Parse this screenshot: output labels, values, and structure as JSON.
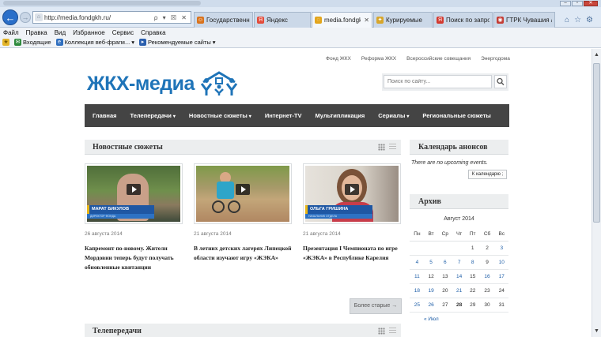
{
  "browser": {
    "address_url": "http://media.fondgkh.ru/",
    "address_tools": "ρ ▾ ☒ ✕",
    "tabs": [
      {
        "label": "Государственная ..."
      },
      {
        "label": "Яндекс"
      },
      {
        "label": "media.fondgkh..."
      },
      {
        "label": "Курируемые"
      },
      {
        "label": "Поиск по запрос..."
      },
      {
        "label": "ГТРК Чувашия / В..."
      }
    ],
    "menu": [
      "Файл",
      "Правка",
      "Вид",
      "Избранное",
      "Сервис",
      "Справка"
    ],
    "favorites": [
      {
        "label": "Входящие"
      },
      {
        "label": "Коллекция веб-фрагм..."
      },
      {
        "label": "Рекомендуемые сайты"
      }
    ]
  },
  "site": {
    "top_links": [
      "Фонд ЖКХ",
      "Реформа ЖКХ",
      "Всероссийские совещания",
      "Энергодома"
    ],
    "logo_text": "ЖКХ-медиа",
    "search_placeholder": "Поиск по сайту...",
    "nav": [
      {
        "label": "Главная",
        "caret": ""
      },
      {
        "label": "Телепередачи",
        "caret": "▾"
      },
      {
        "label": "Новостные сюжеты",
        "caret": "▾"
      },
      {
        "label": "Интернет-TV",
        "caret": ""
      },
      {
        "label": "Мультипликация",
        "caret": ""
      },
      {
        "label": "Сериалы",
        "caret": "▾"
      },
      {
        "label": "Региональные сюжеты",
        "caret": ""
      }
    ]
  },
  "news": {
    "title": "Новостные сюжеты",
    "items": [
      {
        "date": "26 августа 2014",
        "title": "Капремонт по-новому. Жители Мордовии теперь будут получать обновленные квитанции",
        "caption": "МАРАТ БИКУЛОВ",
        "sub": "ДИРЕКТОР ФОНДА"
      },
      {
        "date": "21 августа 2014",
        "title": "В летних детских лагерях Липецкой области изучают игру «ЖЭКА»",
        "caption": "",
        "sub": ""
      },
      {
        "date": "21 августа 2014",
        "title": "Презентация I Чемпионата по игре «ЖЭКА» в Республике Карелия",
        "caption": "ОЛЬГА ГРИШИНА",
        "sub": "НАЧАЛЬНИК ОТДЕЛА"
      }
    ],
    "older_button": "Более старые →"
  },
  "tv": {
    "title": "Телепередачи"
  },
  "calendar": {
    "title": "Календарь анонсов",
    "empty_text": "There are no upcoming events.",
    "button": "К календарю ;"
  },
  "archive": {
    "title": "Архив",
    "month": "Август 2014",
    "weekdays": [
      "Пн",
      "Вт",
      "Ср",
      "Чт",
      "Пт",
      "Сб",
      "Вс"
    ],
    "weeks": [
      [
        {
          "d": ""
        },
        {
          "d": ""
        },
        {
          "d": ""
        },
        {
          "d": ""
        },
        {
          "d": "1"
        },
        {
          "d": "2"
        },
        {
          "d": "3",
          "link": true
        }
      ],
      [
        {
          "d": "4",
          "link": true
        },
        {
          "d": "5",
          "link": true
        },
        {
          "d": "6",
          "link": true
        },
        {
          "d": "7",
          "link": true
        },
        {
          "d": "8",
          "link": true
        },
        {
          "d": "9"
        },
        {
          "d": "10",
          "link": true
        }
      ],
      [
        {
          "d": "11",
          "link": true
        },
        {
          "d": "12"
        },
        {
          "d": "13"
        },
        {
          "d": "14",
          "link": true
        },
        {
          "d": "15"
        },
        {
          "d": "16",
          "link": true
        },
        {
          "d": "17",
          "link": true
        }
      ],
      [
        {
          "d": "18",
          "link": true
        },
        {
          "d": "19",
          "link": true
        },
        {
          "d": "20"
        },
        {
          "d": "21",
          "link": true
        },
        {
          "d": "22"
        },
        {
          "d": "23"
        },
        {
          "d": "24"
        }
      ],
      [
        {
          "d": "25",
          "link": true
        },
        {
          "d": "26",
          "link": true
        },
        {
          "d": "27"
        },
        {
          "d": "28",
          "today": true
        },
        {
          "d": "29"
        },
        {
          "d": "30"
        },
        {
          "d": "31"
        }
      ]
    ],
    "prev_link": "« Июл"
  },
  "colors": {
    "brand_blue": "#1f74b8",
    "nav_bg": "#444444",
    "link": "#1f5fa8"
  }
}
